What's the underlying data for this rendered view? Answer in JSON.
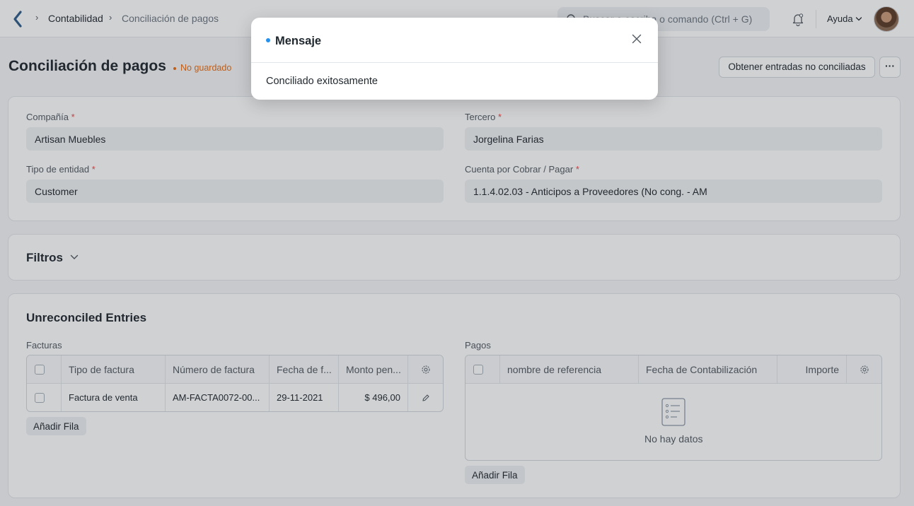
{
  "navbar": {
    "breadcrumbs": [
      "Contabilidad",
      "Conciliación de pagos"
    ],
    "search_placeholder": "Buscar o escriba o comando (Ctrl + G)",
    "help_label": "Ayuda"
  },
  "page": {
    "title": "Conciliación de pagos",
    "status": "No guardado",
    "get_entries_button": "Obtener entradas no conciliadas",
    "more_button": "···"
  },
  "form": {
    "company_label": "Compañía",
    "company_value": "Artisan Muebles",
    "party_label": "Tercero",
    "party_value": "Jorgelina Farias",
    "party_type_label": "Tipo de entidad",
    "party_type_value": "Customer",
    "account_label": "Cuenta por Cobrar / Pagar",
    "account_value": "1.1.4.02.03 - Anticipos a Proveedores (No cong. - AM",
    "required_mark": "*"
  },
  "filters": {
    "title": "Filtros"
  },
  "unreconciled": {
    "title": "Unreconciled Entries",
    "invoices": {
      "label": "Facturas",
      "columns": [
        "Tipo de factura",
        "Número de factura",
        "Fecha de f...",
        "Monto pen..."
      ],
      "rows": [
        {
          "type": "Factura de venta",
          "number": "AM-FACTA0072-00...",
          "date": "29-11-2021",
          "amount": "$ 496,00"
        }
      ],
      "add_row": "Añadir Fila"
    },
    "payments": {
      "label": "Pagos",
      "columns": [
        "nombre de referencia",
        "Fecha de Contabilización",
        "Importe"
      ],
      "empty_text": "No hay datos",
      "add_row": "Añadir Fila"
    }
  },
  "modal": {
    "title": "Mensaje",
    "body": "Conciliado exitosamente"
  },
  "colors": {
    "accent": "#2490ef",
    "warning": "#e86c13",
    "required": "#e24c4c"
  }
}
